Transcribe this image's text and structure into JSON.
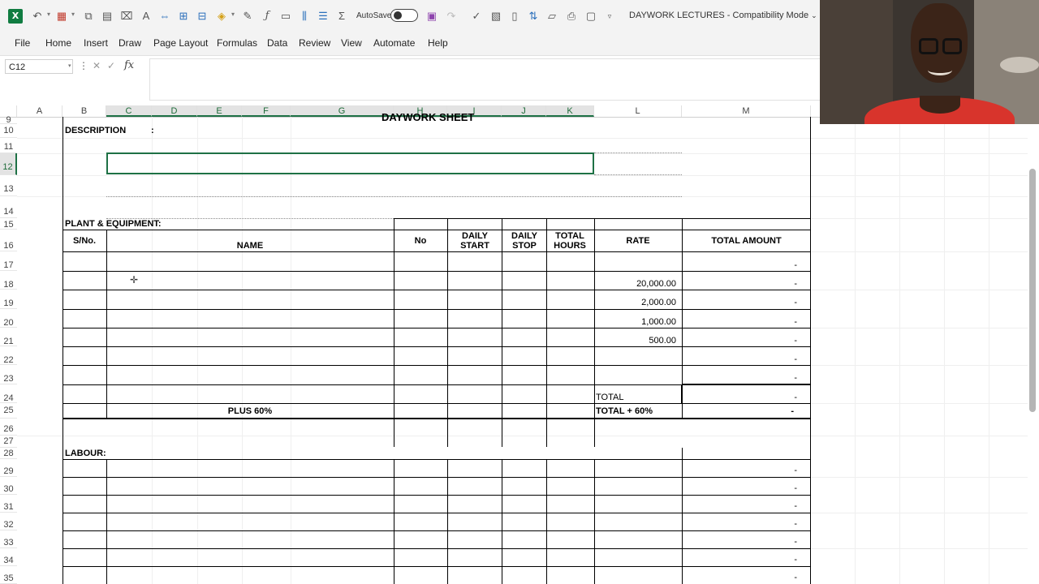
{
  "app": {
    "name": "Excel",
    "logo_letter": "X",
    "doc_title": "DAYWORK  LECTURES  -  Compatibility Mode",
    "autosave_label": "AutoSave"
  },
  "qat_icons": [
    "undo-icon",
    "redo-icon",
    "table-icon",
    "copy-icon",
    "sheet-icon",
    "clear-format-icon",
    "merge-icon",
    "filter-icon",
    "fill-color-icon",
    "function-icon",
    "chart-icon",
    "insert-column-icon",
    "insert-row-icon",
    "sum-icon",
    "save-icon",
    "redo-disabled-icon",
    "spelling-icon",
    "image-icon",
    "sort-icon",
    "open-folder-icon",
    "print-icon",
    "print-preview-icon",
    "more-icon"
  ],
  "menu": [
    "File",
    "Home",
    "Insert",
    "Draw",
    "Page Layout",
    "Formulas",
    "Data",
    "Review",
    "View",
    "Automate",
    "Help"
  ],
  "formula_bar": {
    "name_box": "C12",
    "fx": "fx",
    "value": ""
  },
  "columns": [
    "A",
    "B",
    "C",
    "D",
    "E",
    "F",
    "G",
    "H",
    "I",
    "J",
    "K",
    "L",
    "M"
  ],
  "rows": [
    "9",
    "10",
    "11",
    "12",
    "13",
    "14",
    "15",
    "16",
    "17",
    "18",
    "19",
    "20",
    "21",
    "22",
    "23",
    "24",
    "25",
    "26",
    "27",
    "28",
    "29",
    "30",
    "31",
    "32",
    "33",
    "34",
    "35"
  ],
  "sheet": {
    "title": "DAYWORK SHEET",
    "description_label": "DESCRIPTION",
    "description_colon": ":",
    "plant_label": "PLANT & EQUIPMENT:",
    "headers": {
      "sno": "S/No.",
      "name": "NAME",
      "no": "No",
      "daily_start": "DAILY START",
      "daily_stop": "DAILY STOP",
      "total_hours": "TOTAL HOURS",
      "rate": "RATE",
      "total_amount": "TOTAL AMOUNT"
    },
    "plant_rows": [
      {
        "rate": "",
        "amount": "-"
      },
      {
        "rate": "20,000.00",
        "amount": "-"
      },
      {
        "rate": "2,000.00",
        "amount": "-"
      },
      {
        "rate": "1,000.00",
        "amount": "-"
      },
      {
        "rate": "500.00",
        "amount": "-"
      },
      {
        "rate": "",
        "amount": "-"
      },
      {
        "rate": "",
        "amount": "-"
      }
    ],
    "total_label": "TOTAL",
    "total_value": "-",
    "plus_label": "PLUS 60%",
    "total_plus_label": "TOTAL + 60%",
    "total_plus_value": "-",
    "labour_label": "LABOUR:",
    "labour_amounts": [
      "-",
      "-",
      "-",
      "-",
      "-",
      "-",
      "-"
    ]
  },
  "webcam": {
    "description": ""
  }
}
